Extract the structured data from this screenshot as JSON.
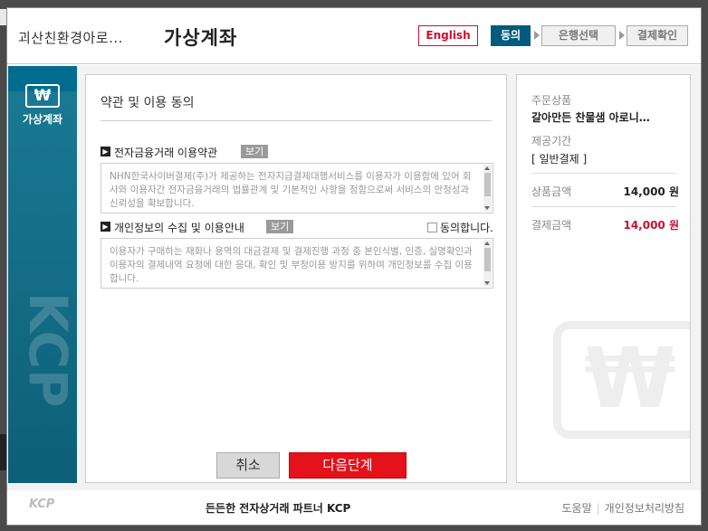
{
  "header": {
    "merchant_name": "괴산친환경아로...",
    "title": "가상계좌",
    "language_button": "English",
    "steps": [
      {
        "label": "동의",
        "active": true
      },
      {
        "label": "은행선택",
        "active": false
      },
      {
        "label": "결제확인",
        "active": false
      }
    ]
  },
  "brand": {
    "icon_symbol": "₩",
    "label": "가상계좌",
    "watermark": "KCP"
  },
  "terms": {
    "section_title": "약관 및 이용 동의",
    "items": [
      {
        "label": "전자금융거래 이용약관",
        "view_label": "보기",
        "text": "NHN한국사이버결제(주)가 제공하는 전자지급결제대행서비스를 이용자가 이용함에 있어 회사와 이용자간 전자금융거래의 법률관계 및 기본적인 사항을 정함으로써 서비스의 안정성과 신뢰성을 확보합니다."
      },
      {
        "label": "개인정보의 수집 및 이용안내",
        "view_label": "보기",
        "text": "이용자가 구매하는 재화나 용역의 대금결제 및 결제진행 과정 중 본인식별, 인증, 실명확인과 이용자의 결제내역 요청에 대한 응대, 확인 및 부정이용 방지를 위하여 개인정보를 수집 이용합니다."
      }
    ],
    "agree_label": "동의합니다."
  },
  "actions": {
    "cancel": "취소",
    "next": "다음단계"
  },
  "summary": {
    "product_label": "주문상품",
    "product_name": "갈아만든 찬물샘 아로니…",
    "period_label": "제공기간",
    "period_value": "[ 일반결제 ]",
    "price_label": "상품금액",
    "price_value": "14,000 원",
    "pay_label": "결제금액",
    "pay_value": "14,000 원"
  },
  "footer": {
    "logo": "KCP",
    "tagline": "든든한 전자상거래 파트너 KCP",
    "help_link": "도움말",
    "privacy_link": "개인정보처리방침"
  },
  "colors": {
    "accent_red": "#e3121b",
    "brand_teal": "#0e5f78",
    "active_step": "#005b7f"
  }
}
